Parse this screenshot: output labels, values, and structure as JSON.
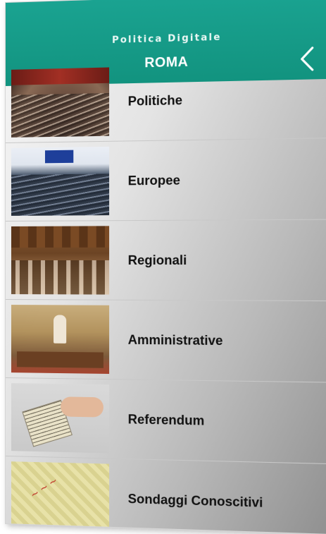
{
  "header": {
    "subtitle": "Politica Digitale",
    "title": "ROMA",
    "back_icon": "chevron-left-icon"
  },
  "colors": {
    "header_bg": "#15998a",
    "text": "#111111"
  },
  "list": {
    "items": [
      {
        "label": "Politiche"
      },
      {
        "label": "Europee"
      },
      {
        "label": "Regionali"
      },
      {
        "label": "Amministrative"
      },
      {
        "label": "Referendum"
      },
      {
        "label": "Sondaggi Conoscitivi"
      }
    ]
  }
}
